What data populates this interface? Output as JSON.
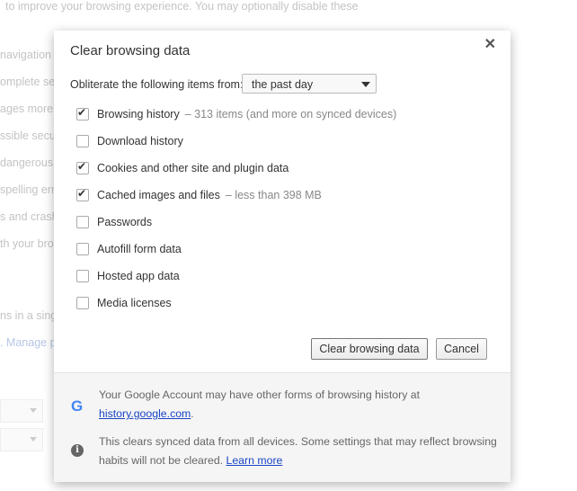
{
  "background": {
    "lines": [
      "to improve your browsing experience. You may optionally disable these",
      "navigation",
      "omplete sea",
      "ages more",
      "ssible secu",
      "dangerous",
      "spelling err",
      "s and crash",
      "th your brow",
      "ns in a single"
    ],
    "manage_link": ". Manage p"
  },
  "dialog": {
    "title": "Clear browsing data",
    "close_icon": "close-icon",
    "from_label": "Obliterate the following items from:",
    "time_range": "the past day",
    "items": [
      {
        "label": "Browsing history",
        "detail": "–  313 items (and more on synced devices)",
        "checked": true
      },
      {
        "label": "Download history",
        "detail": "",
        "checked": false
      },
      {
        "label": "Cookies and other site and plugin data",
        "detail": "",
        "checked": true
      },
      {
        "label": "Cached images and files",
        "detail": "–  less than 398 MB",
        "checked": true
      },
      {
        "label": "Passwords",
        "detail": "",
        "checked": false
      },
      {
        "label": "Autofill form data",
        "detail": "",
        "checked": false
      },
      {
        "label": "Hosted app data",
        "detail": "",
        "checked": false
      },
      {
        "label": "Media licenses",
        "detail": "",
        "checked": false
      }
    ],
    "clear_button": "Clear browsing data",
    "cancel_button": "Cancel",
    "footer": {
      "google_text": "Your Google Account may have other forms of browsing history at",
      "google_link": "history.google.com",
      "google_after": ".",
      "sync_text": "This clears synced data from all devices. Some settings that may reflect browsing habits will not be cleared.",
      "learn_more": "Learn more"
    }
  }
}
